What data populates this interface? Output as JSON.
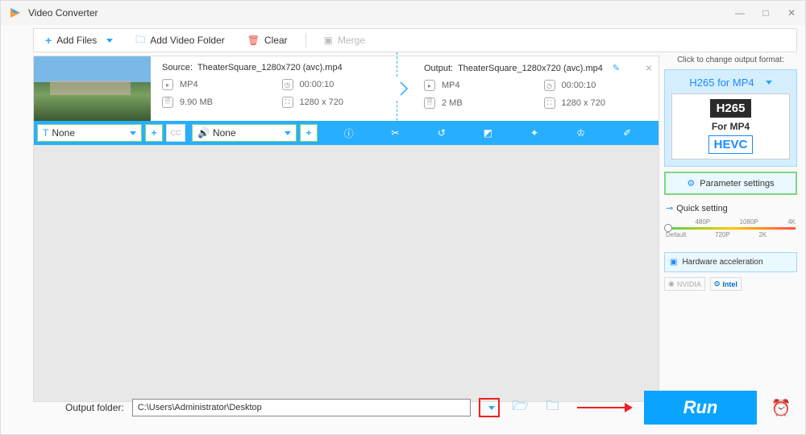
{
  "titlebar": {
    "title": "Video Converter"
  },
  "toolbar": {
    "add_files": "Add Files",
    "add_folder": "Add Video Folder",
    "clear": "Clear",
    "merge": "Merge"
  },
  "file": {
    "source": {
      "label": "Source:",
      "name": "TheaterSquare_1280x720 (avc).mp4",
      "format": "MP4",
      "duration": "00:00:10",
      "size": "9.90 MB",
      "resolution": "1280 x 720"
    },
    "output": {
      "label": "Output:",
      "name": "TheaterSquare_1280x720 (avc).mp4",
      "format": "MP4",
      "duration": "00:00:10",
      "size": "2 MB",
      "resolution": "1280 x 720"
    }
  },
  "actionbar": {
    "subtitle_none": "None",
    "audio_none": "None",
    "cc": "CC"
  },
  "right_panel": {
    "click_label": "Click to change output format:",
    "format_title": "H265 for MP4",
    "badge_top": "H265",
    "badge_mid": "For MP4",
    "badge_bot": "HEVC",
    "param_settings": "Parameter settings",
    "quick_setting": "Quick setting",
    "slider": {
      "p480": "480P",
      "p720": "720P",
      "p1080": "1080P",
      "p2k": "2K",
      "p4k": "4K",
      "default": "Default"
    },
    "hw_accel": "Hardware acceleration",
    "nvidia": "NVIDIA",
    "intel": "Intel"
  },
  "bottom": {
    "label": "Output folder:",
    "path": "C:\\Users\\Administrator\\Desktop",
    "run": "Run"
  }
}
